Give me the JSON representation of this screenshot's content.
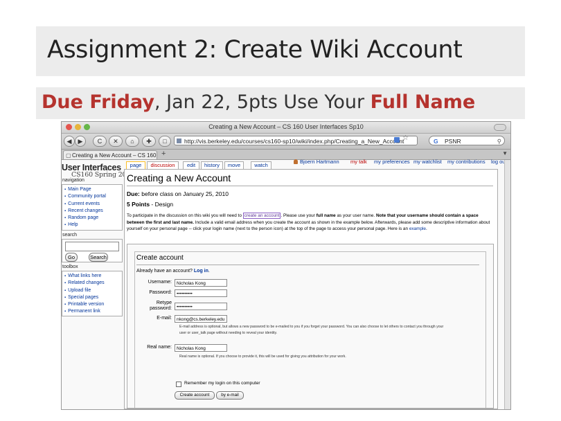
{
  "slide": {
    "title": "Assignment 2: Create Wiki Account",
    "subtitle_due": "Due Friday",
    "subtitle_date": ", Jan 22, 5pts Use Your ",
    "subtitle_fullname": "Full Name"
  },
  "browser": {
    "window_title": "Creating a New Account – CS 160 User Interfaces Sp10",
    "url": "http://vis.berkeley.edu/courses/cs160-sp10/wiki/index.php/Creating_a_New_Account",
    "search_value": "PSNR",
    "tab_label": "Creating a New Account – CS 160 ...",
    "nav_buttons": [
      "◀",
      "▶",
      "C",
      "✕",
      "⌂",
      "✚",
      "□"
    ]
  },
  "wiki": {
    "logo_line1": "User Interfaces",
    "logo_line2": "CS160 Spring 2010",
    "tabs": [
      "page",
      "discussion",
      "edit",
      "history",
      "move",
      "watch"
    ],
    "user_links": [
      "Bjoern Hartmann",
      "my talk",
      "my preferences",
      "my watchlist",
      "my contributions",
      "log out"
    ],
    "navigation_label": "navigation",
    "navigation": [
      "Main Page",
      "Community portal",
      "Current events",
      "Recent changes",
      "Random page",
      "Help"
    ],
    "search_label": "search",
    "go_label": "Go",
    "search_button_label": "Search",
    "toolbox_label": "toolbox",
    "toolbox": [
      "What links here",
      "Related changes",
      "Upload file",
      "Special pages",
      "Printable version",
      "Permanent link"
    ]
  },
  "article": {
    "heading": "Creating a New Account",
    "due_label": "Due:",
    "due_text": " before class on January 25, 2010",
    "points_label": "5 Points",
    "points_text": " - Design",
    "para_1": "To participate in the discussion on this wiki you will need to ",
    "para_link": "create an account",
    "para_2": ". Please use your ",
    "para_bold1": "full name",
    "para_3": " as your user name. ",
    "para_bold2": "Note that your username should contain a space between the first and last name.",
    "para_4": " Include a valid email address when you create the account as shown in the example below. Afterwards, please add some descriptive information about yourself on your personal page -- click your login name (next to the person icon) at the top of the page to access your personal page. Here is an ",
    "para_link2": "example",
    "para_5": "."
  },
  "create_account": {
    "title": "Create account",
    "have_account": "Already have an account? ",
    "login_link": "Log in",
    "login_after": ".",
    "username_label": "Username:",
    "username_value": "Nicholas Kong",
    "password_label": "Password:",
    "password_value": "••••••••••",
    "retype_label_1": "Retype",
    "retype_label_2": "password:",
    "retype_value": "••••••••••",
    "email_label": "E-mail:",
    "email_value": "nkong@cs.berkeley.edu",
    "email_note_1": "E-mail address is optional, but allows a new password to be e-mailed to you if you forget your password. You can also choose to let others to contact you through your",
    "email_note_2": "user or user_talk page without needing to reveal your identity.",
    "realname_label": "Real name:",
    "realname_value": "Nicholas Kong",
    "realname_note": "Real name is optional. If you choose to provide it, this will be used for giving you attribution for your work.",
    "remember_label": "Remember my login on this computer",
    "create_button": "Create account",
    "email_button": "by e-mail"
  }
}
